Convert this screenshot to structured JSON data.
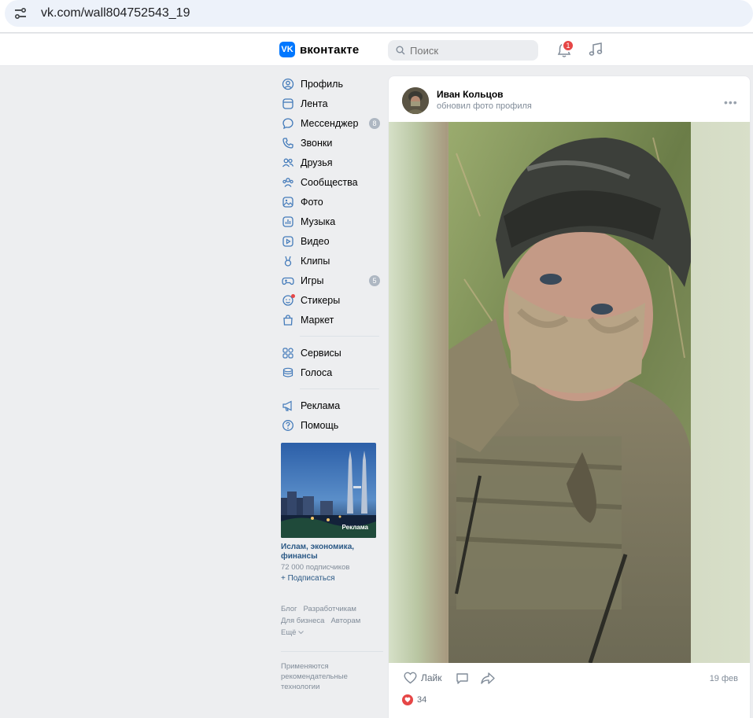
{
  "browser": {
    "url": "vk.com/wall804752543_19"
  },
  "header": {
    "logo_text": "вконтакте",
    "search_placeholder": "Поиск",
    "notification_count": "1"
  },
  "sidebar": {
    "items": [
      {
        "label": "Профиль",
        "icon": "profile-icon"
      },
      {
        "label": "Лента",
        "icon": "feed-icon"
      },
      {
        "label": "Мессенджер",
        "icon": "messenger-icon",
        "count": "8"
      },
      {
        "label": "Звонки",
        "icon": "phone-icon"
      },
      {
        "label": "Друзья",
        "icon": "friends-icon"
      },
      {
        "label": "Сообщества",
        "icon": "communities-icon"
      },
      {
        "label": "Фото",
        "icon": "photo-icon"
      },
      {
        "label": "Музыка",
        "icon": "music-icon"
      },
      {
        "label": "Видео",
        "icon": "video-icon"
      },
      {
        "label": "Клипы",
        "icon": "clips-icon"
      },
      {
        "label": "Игры",
        "icon": "games-icon",
        "count": "5"
      },
      {
        "label": "Стикеры",
        "icon": "stickers-icon"
      },
      {
        "label": "Маркет",
        "icon": "market-icon"
      }
    ],
    "items2": [
      {
        "label": "Сервисы",
        "icon": "services-icon"
      },
      {
        "label": "Голоса",
        "icon": "votes-icon"
      }
    ],
    "items3": [
      {
        "label": "Реклама",
        "icon": "ads-icon"
      },
      {
        "label": "Помощь",
        "icon": "help-icon"
      }
    ]
  },
  "ad": {
    "label": "Реклама",
    "title": "Ислам, экономика, финансы",
    "subscribers": "72 000 подписчиков",
    "subscribe": "+ Подписаться"
  },
  "footer": {
    "blog": "Блог",
    "developers": "Разработчикам",
    "business": "Для бизнеса",
    "authors": "Авторам",
    "more": "Ещё",
    "note": "Применяются рекомендательные технологии"
  },
  "post": {
    "author": "Иван Кольцов",
    "action": "обновил фото профиля",
    "like_label": "Лайк",
    "date": "19 фев",
    "reaction_count": "34"
  },
  "colors": {
    "accent": "#0077ff",
    "link": "#2a5885",
    "badge_red": "#e64646",
    "counter_gray": "#aeb7c2"
  }
}
